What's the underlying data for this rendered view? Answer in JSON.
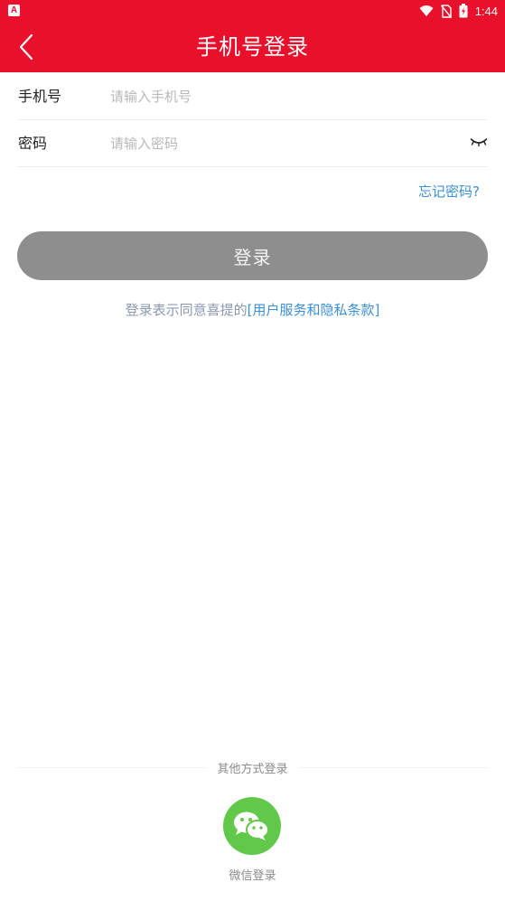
{
  "status_bar": {
    "app_icon_letter": "A",
    "time": "1:44",
    "icons": [
      "wifi-icon",
      "no-sim-icon",
      "battery-icon"
    ]
  },
  "app_bar": {
    "title": "手机号登录",
    "back_icon": "chevron-left-icon"
  },
  "form": {
    "phone": {
      "label": "手机号",
      "value": "",
      "placeholder": "请输入手机号"
    },
    "password": {
      "label": "密码",
      "value": "",
      "placeholder": "请输入密码",
      "toggle_icon": "eye-closed-icon"
    },
    "forgot_password": "忘记密码?"
  },
  "login_button": "登录",
  "agreement": {
    "prefix": "登录表示同意喜提的",
    "link": "[用户服务和隐私条款]"
  },
  "other_login": {
    "label": "其他方式登录",
    "wechat_label": "微信登录",
    "wechat_icon": "wechat-icon"
  },
  "colors": {
    "brand_red": "#e8102a",
    "link_blue": "#3a8fd6",
    "button_gray": "#8e8e8e",
    "wechat_green": "#62c84a"
  }
}
